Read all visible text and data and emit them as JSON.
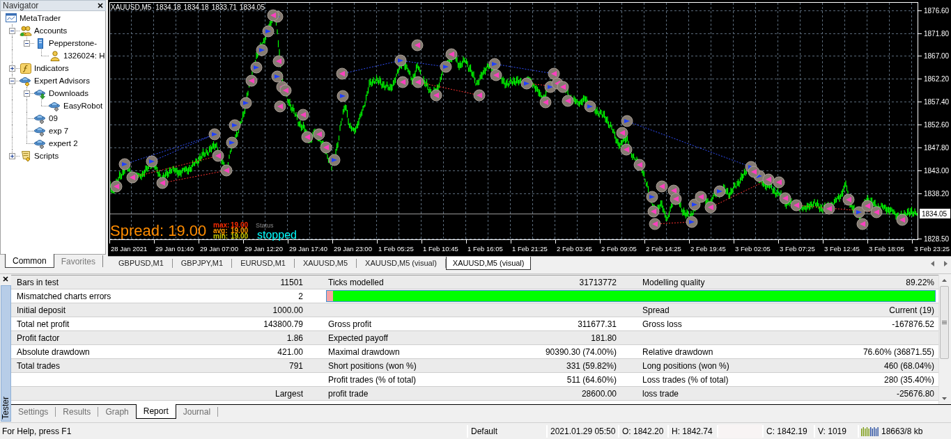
{
  "navigator": {
    "title": "Navigator",
    "tree": [
      {
        "label": "MetaTrader",
        "kind": "terminal",
        "children": [
          {
            "label": "Accounts",
            "kind": "accounts",
            "expanded": true,
            "children": [
              {
                "label": "Pepperstone-",
                "kind": "server",
                "expanded": true,
                "children": [
                  {
                    "label": "1326024: H",
                    "kind": "account"
                  }
                ]
              }
            ]
          },
          {
            "label": "Indicators",
            "kind": "indicators",
            "expanded": false
          },
          {
            "label": "Expert Advisors",
            "kind": "experts",
            "expanded": true,
            "children": [
              {
                "label": "Downloads",
                "kind": "downloads",
                "expanded": true,
                "children": [
                  {
                    "label": "EasyRobot",
                    "kind": "expert"
                  }
                ]
              },
              {
                "label": "09",
                "kind": "expert"
              },
              {
                "label": "exp 7",
                "kind": "expert"
              },
              {
                "label": "expert 2",
                "kind": "expert"
              }
            ]
          },
          {
            "label": "Scripts",
            "kind": "scripts",
            "expanded": false
          }
        ]
      }
    ],
    "tabs": [
      {
        "label": "Common",
        "selected": true
      },
      {
        "label": "Favorites",
        "selected": false
      }
    ]
  },
  "chart": {
    "symbol": "XAUUSD,M5",
    "ohlc": [
      "1834.18",
      "1834.18",
      "1833.71",
      "1834.05"
    ],
    "price_labels": [
      "1876.60",
      "1871.80",
      "1867.00",
      "1862.20",
      "1857.40",
      "1852.60",
      "1847.80",
      "1843.00",
      "1838.20",
      "1828.50"
    ],
    "current_price": "1834.05",
    "time_labels": [
      "28 Jan 2021",
      "29 Jan 01:40",
      "29 Jan 07:00",
      "29 Jan 12:20",
      "29 Jan 17:40",
      "29 Jan 23:00",
      "1 Feb 05:25",
      "1 Feb 10:45",
      "1 Feb 16:05",
      "1 Feb 21:25",
      "2 Feb 03:45",
      "2 Feb 09:05",
      "2 Feb 14:25",
      "2 Feb 19:45",
      "3 Feb 02:05",
      "3 Feb 07:25",
      "3 Feb 12:45",
      "3 Feb 18:05",
      "3 Feb 23:25"
    ],
    "spread": {
      "text": "Spread: 19.00",
      "stats": [
        {
          "label": "max:",
          "value": "19.00",
          "color": "#ff2a00"
        },
        {
          "label": "avg:",
          "value": "19.00",
          "color": "#ff9900"
        },
        {
          "label": "min:",
          "value": "19.00",
          "color": "#cccc00"
        }
      ]
    },
    "status": {
      "label": "Status",
      "value": "stopped"
    }
  },
  "chart_tabs": [
    {
      "label": "GBPUSD,M1",
      "selected": false
    },
    {
      "label": "GBPJPY,M1",
      "selected": false
    },
    {
      "label": "EURUSD,M1",
      "selected": false
    },
    {
      "label": "XAUUSD,M5",
      "selected": false
    },
    {
      "label": "XAUUSD,M5 (visual)",
      "selected": false
    },
    {
      "label": "XAUUSD,M5 (visual)",
      "selected": true
    }
  ],
  "tester": {
    "title": "Tester",
    "report_rows": [
      {
        "kind": "stats",
        "label_1": "Bars in test",
        "value_1": "11501",
        "label_2": "Ticks modelled",
        "value_2": "31713772",
        "label_3": "Modelling quality",
        "value_3": "89.22%"
      },
      {
        "kind": "quality",
        "label_1": "Mismatched charts errors",
        "value_1": "2",
        "level": 0.99
      },
      {
        "kind": "stats",
        "label_1": "Initial deposit",
        "value_1": "1000.00",
        "label_3": "Spread",
        "value_3": "Current (19)"
      },
      {
        "kind": "stats",
        "label_1": "Total net profit",
        "value_1": "143800.79",
        "label_2": "Gross profit",
        "value_2": "311677.31",
        "label_3": "Gross loss",
        "value_3": "-167876.52"
      },
      {
        "kind": "stats",
        "label_1": "Profit factor",
        "value_1": "1.86",
        "label_2": "Expected payoff",
        "value_2": "181.80"
      },
      {
        "kind": "stats",
        "label_1": "Absolute drawdown",
        "value_1": "421.00",
        "label_2": "Maximal drawdown",
        "value_2": "90390.30 (74.00%)",
        "label_3": "Relative drawdown",
        "value_3": "76.60% (36871.55)"
      },
      {
        "kind": "stats",
        "label_1": "Total trades",
        "value_1": "791",
        "label_2": "Short positions (won %)",
        "value_2": "331 (59.82%)",
        "label_3": "Long positions (won %)",
        "value_3": "460 (68.04%)"
      },
      {
        "kind": "stats",
        "label_2": "Profit trades (% of total)",
        "value_2": "511 (64.60%)",
        "label_3": "Loss trades (% of total)",
        "value_3": "280 (35.40%)"
      },
      {
        "kind": "stats",
        "value_1": "Largest",
        "label_2": "profit trade",
        "value_2": "28600.00",
        "label_3": "loss trade",
        "value_3": "-25676.80"
      }
    ],
    "tabs": [
      {
        "label": "Settings",
        "selected": false
      },
      {
        "label": "Results",
        "selected": false
      },
      {
        "label": "Graph",
        "selected": false
      },
      {
        "label": "Report",
        "selected": true
      },
      {
        "label": "Journal",
        "selected": false
      }
    ]
  },
  "status_bar": {
    "help": "For Help, press F1",
    "profile": "Default",
    "datetime": "2021.01.29 05:50",
    "open": "O: 1842.20",
    "high": "H: 1842.74",
    "close": "C: 1842.19",
    "volume": "V: 1019",
    "traffic": "18663/8 kb"
  }
}
